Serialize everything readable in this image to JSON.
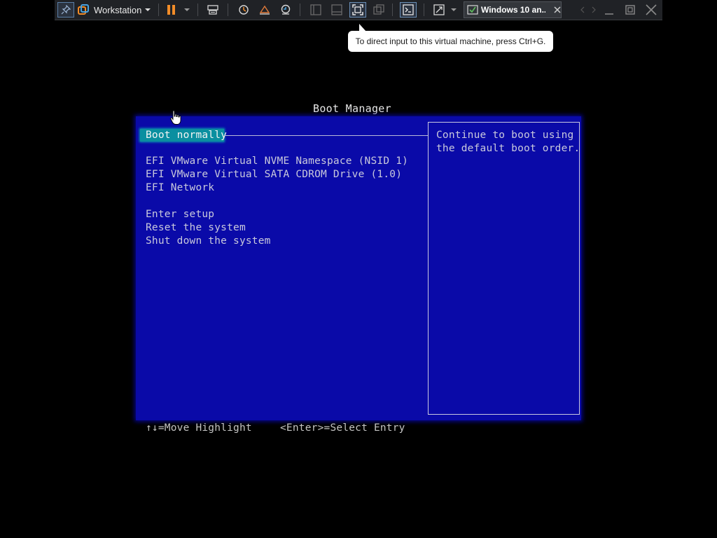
{
  "toolbar": {
    "brand_label": "Workstation",
    "vm_tab_label": "Windows 10 an...",
    "icons": {
      "pin": "pin-icon",
      "brand": "vmware-logo-icon",
      "pause": "pause-icon",
      "send_keys": "send-ctrl-alt-del-icon",
      "snapshot": "take-snapshot-icon",
      "revert": "revert-snapshot-icon",
      "snapshot_manager": "snapshot-manager-icon",
      "library": "show-library-icon",
      "thumbnail": "thumbnail-bar-icon",
      "fullscreen": "full-screen-icon",
      "unity": "unity-icon",
      "console": "console-view-icon",
      "stretch": "stretch-guest-icon",
      "vm": "vm-tab-icon",
      "close_tab": "close-tab-icon",
      "minimize": "minimize-icon",
      "restore": "restore-icon",
      "close": "close-window-icon"
    },
    "accent_color": "#f28c28"
  },
  "tooltip": {
    "text": "To direct input to this virtual machine, press Ctrl+G."
  },
  "boot_manager": {
    "title": "Boot Manager",
    "items": [
      "Boot normally",
      "EFI VMware Virtual NVME Namespace (NSID 1)",
      "EFI VMware Virtual SATA CDROM Drive (1.0)",
      "EFI Network",
      "Enter setup",
      "Reset the system",
      "Shut down the system"
    ],
    "selected_index": 0,
    "description": [
      "Continue to boot using",
      "the default boot order."
    ],
    "footer_move": "↑↓=Move Highlight",
    "footer_select": "<Enter>=Select Entry",
    "colors": {
      "panel": "#0a0aa8",
      "highlight": "#0a8fa0",
      "text": "#c9c9dc"
    }
  }
}
